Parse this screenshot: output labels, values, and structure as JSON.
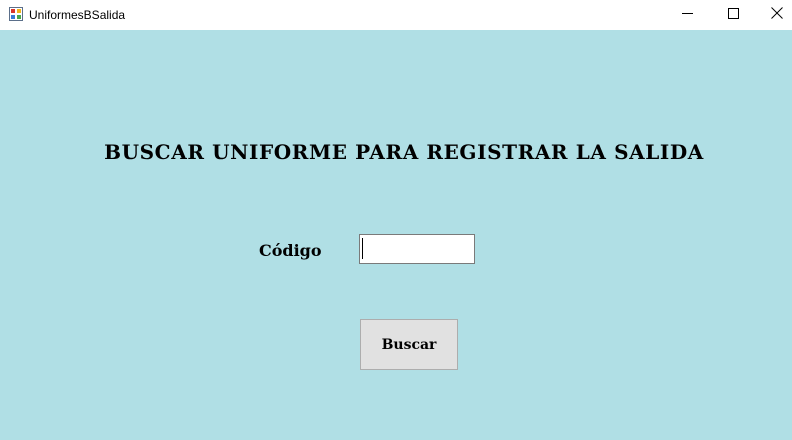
{
  "window": {
    "title": "UniformesBSalida",
    "app_icon": "winforms-app-icon",
    "controls": {
      "minimize_icon": "minimize-icon",
      "maximize_icon": "maximize-icon",
      "close_icon": "close-icon"
    }
  },
  "form": {
    "heading": "BUSCAR UNIFORME PARA REGISTRAR LA SALIDA",
    "codigo_label": "Código",
    "codigo_value": "",
    "search_button_label": "Buscar"
  },
  "colors": {
    "form_background": "#b0dfe5",
    "button_background": "#e1e1e1",
    "titlebar_background": "#ffffff"
  }
}
